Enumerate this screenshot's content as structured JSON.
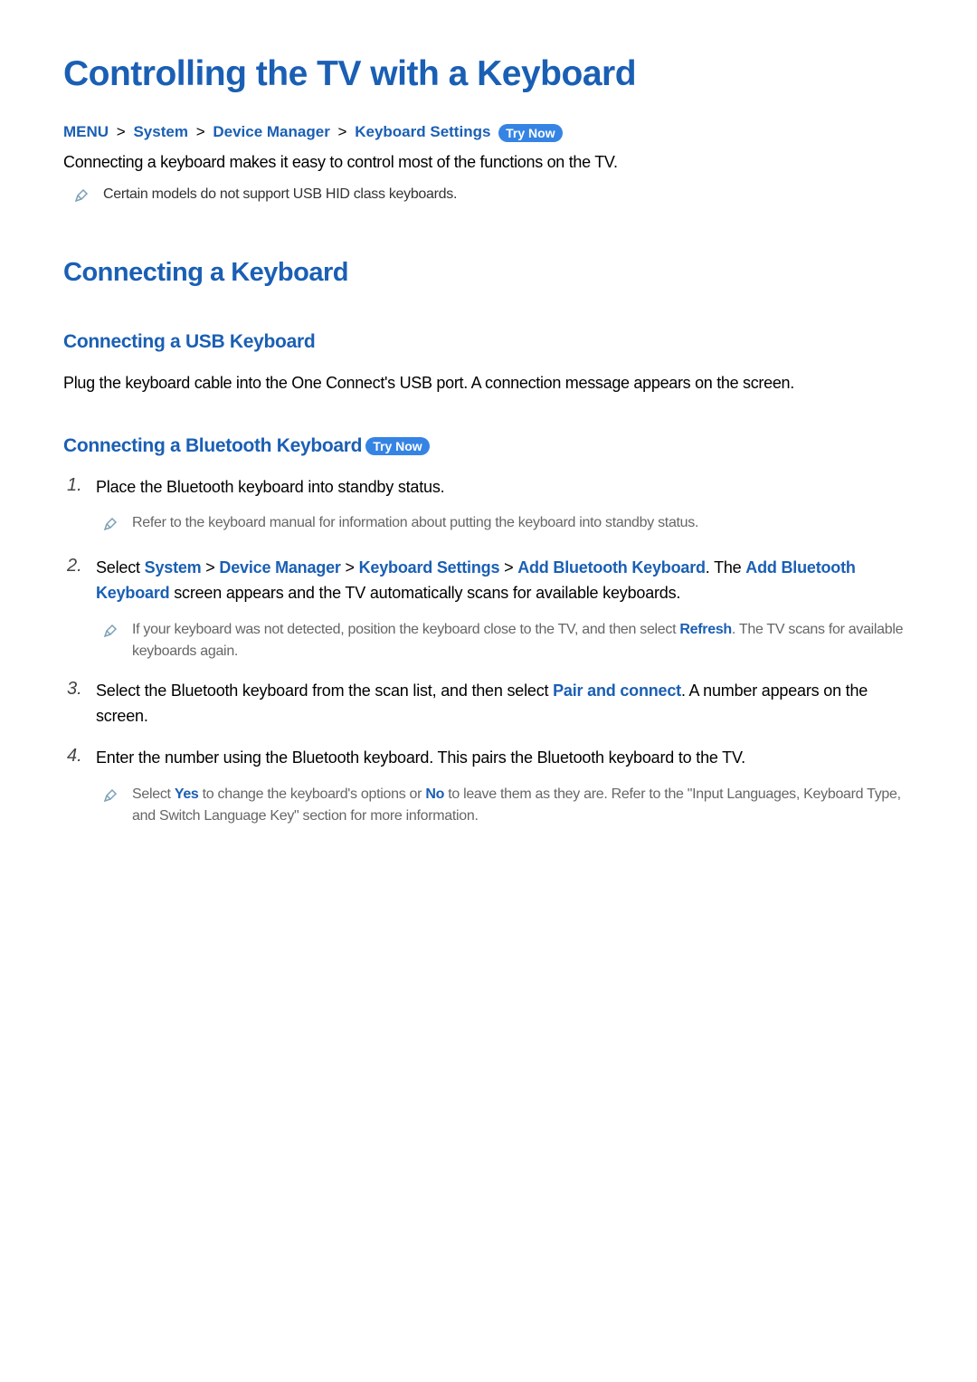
{
  "page": {
    "title": "Controlling the TV with a Keyboard"
  },
  "breadcrumb": {
    "items": [
      "MENU",
      "System",
      "Device Manager",
      "Keyboard Settings"
    ],
    "sep": ">",
    "try_now": "Try Now"
  },
  "intro": {
    "text": "Connecting a keyboard makes it easy to control most of the functions on the TV.",
    "note": "Certain models do not support USB HID class keyboards."
  },
  "section1": {
    "heading": "Connecting a Keyboard"
  },
  "section2": {
    "heading": "Connecting a USB Keyboard",
    "body": "Plug the keyboard cable into the One Connect's USB port. A connection message appears on the screen."
  },
  "section3": {
    "heading": "Connecting a Bluetooth Keyboard",
    "try_now": "Try Now",
    "steps": [
      {
        "num": "1.",
        "text": "Place the Bluetooth keyboard into standby status.",
        "note": "Refer to the keyboard manual for information about putting the keyboard into standby status."
      },
      {
        "num": "2.",
        "text_pre": "Select ",
        "path": [
          "System",
          "Device Manager",
          "Keyboard Settings",
          "Add Bluetooth Keyboard"
        ],
        "text_mid1": ". The ",
        "keyword1": "Add Bluetooth Keyboard",
        "text_post": " screen appears and the TV automatically scans for available keyboards.",
        "note_pre": "If your keyboard was not detected, position the keyboard close to the TV, and then select ",
        "note_keyword": "Refresh",
        "note_post": ". The TV scans for available keyboards again."
      },
      {
        "num": "3.",
        "text_pre": "Select the Bluetooth keyboard from the scan list, and then select ",
        "keyword": "Pair and connect",
        "text_post": ". A number appears on the screen."
      },
      {
        "num": "4.",
        "text": "Enter the number using the Bluetooth keyboard. This pairs the Bluetooth keyboard to the TV.",
        "note_pre": "Select ",
        "note_kw1": "Yes",
        "note_mid": " to change the keyboard's options or ",
        "note_kw2": "No",
        "note_post": " to leave them as they are. Refer to the \"Input Languages, Keyboard Type, and Switch Language Key\" section for more information."
      }
    ]
  }
}
